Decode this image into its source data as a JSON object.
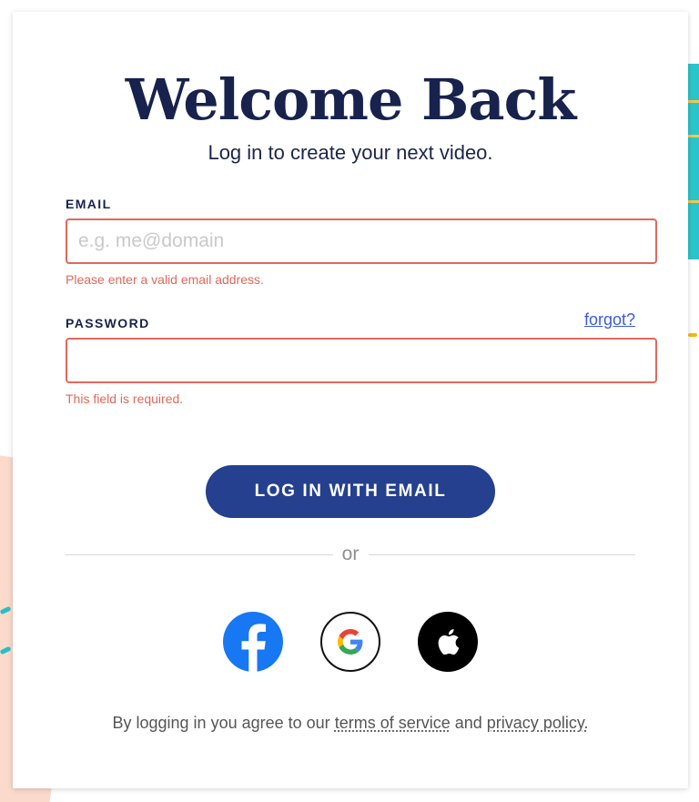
{
  "page": {
    "title": "Welcome Back",
    "subtitle": "Log in to create your next video."
  },
  "form": {
    "email": {
      "label": "EMAIL",
      "value": "",
      "placeholder": "e.g. me@domain",
      "error": "Please enter a valid email address."
    },
    "password": {
      "label": "PASSWORD",
      "value": "",
      "placeholder": "",
      "error": "This field is required.",
      "forgot_label": "forgot?"
    },
    "submit_label": "LOG IN WITH EMAIL"
  },
  "divider_text": "or",
  "social": [
    {
      "name": "facebook",
      "icon": "facebook-icon",
      "color": "#1877f2"
    },
    {
      "name": "google",
      "icon": "google-icon",
      "color": "#ffffff"
    },
    {
      "name": "apple",
      "icon": "apple-icon",
      "color": "#000000"
    }
  ],
  "footer": {
    "prefix": "By logging in you agree to our",
    "terms_label": "terms of service",
    "conjunction": "and",
    "privacy_label": "privacy policy."
  },
  "colors": {
    "brand_navy": "#17224d",
    "button_blue": "#24408e",
    "error_red": "#e0695b",
    "link_blue": "#3b5bdb"
  }
}
